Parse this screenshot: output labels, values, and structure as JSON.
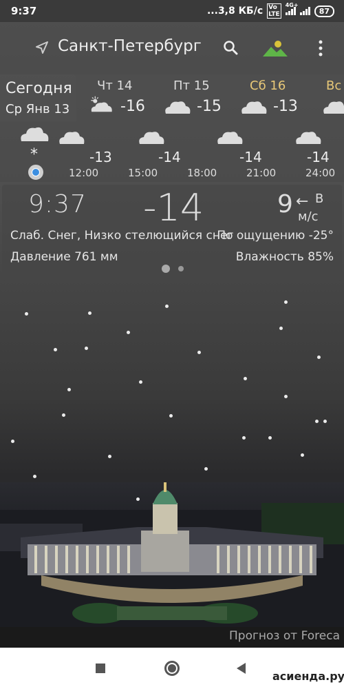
{
  "status_bar": {
    "time": "9:37",
    "network_speed": "...3,8 КБ/с",
    "network_type": "4G+",
    "battery": "87",
    "icons": [
      "volte-icon",
      "signal-icon",
      "wifi-signal-icon",
      "battery-icon"
    ]
  },
  "header": {
    "city": "Санкт-Петербург",
    "icons": [
      "location-arrow-icon",
      "search-icon",
      "landscape-icon",
      "more-vert-icon"
    ]
  },
  "days": {
    "today_label": "Сегодня",
    "today_date": "Ср Янв 13",
    "items": [
      {
        "name": "Чт 14",
        "temp": "-16",
        "icon": "sun-cloud-icon",
        "highlight": false
      },
      {
        "name": "Пт 15",
        "temp": "-15",
        "icon": "cloud-icon",
        "highlight": false
      },
      {
        "name": "Сб 16",
        "temp": "-13",
        "icon": "cloud-icon",
        "highlight": true
      },
      {
        "name": "Вс",
        "temp": "",
        "icon": "cloud-icon",
        "highlight": true
      }
    ],
    "weekend_color": "#e8c878"
  },
  "hourly": {
    "items": [
      {
        "time": "12:00",
        "temp": "-13"
      },
      {
        "time": "15:00",
        "temp": "-14"
      },
      {
        "time": "18:00",
        "temp": ""
      },
      {
        "time": "21:00",
        "temp": "-14"
      },
      {
        "time": "24:00",
        "temp": "-14"
      }
    ],
    "now_icon": "snow-cloud-icon",
    "now_marker": "*"
  },
  "current": {
    "time": "9:37",
    "temp": "-14",
    "wind_speed": "9",
    "wind_arrow": "←",
    "wind_dir": "В",
    "wind_unit": "м/с",
    "condition": "Слаб. Снег, Низко стелющийся снег",
    "feels_like": "По ощущению -25°",
    "pressure": "Давление 761 мм",
    "humidity": "Влажность 85%"
  },
  "provider": "Прогноз от Foreca",
  "watermark": "асиенда.ру",
  "colors": {
    "panel": "#464646",
    "accent_dot": "#3d8fe0",
    "icon_yellow": "#d9c23a",
    "icon_green": "#5fb548"
  }
}
